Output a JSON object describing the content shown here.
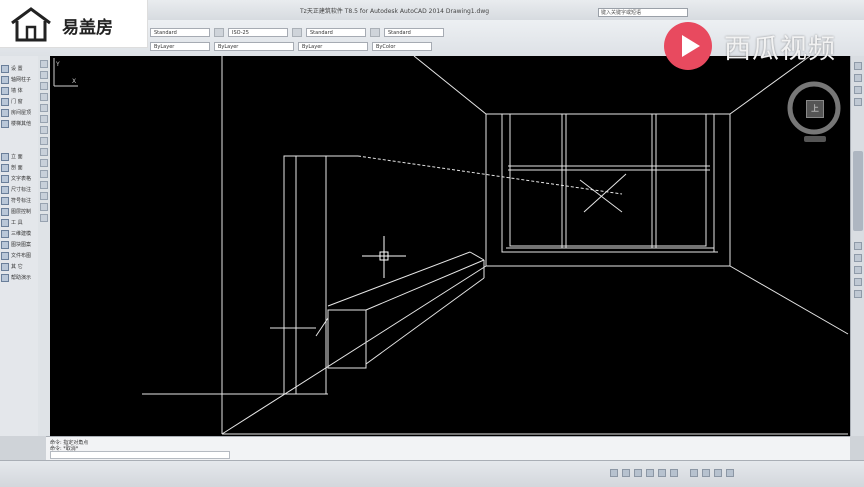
{
  "app": {
    "title": "Tz天正建筑软件 T8.5 for Autodesk AutoCAD 2014   Drawing1.dwg",
    "search_placeholder": "键入关键字或短语"
  },
  "branding": {
    "logo_text": "易盖房",
    "watermark_text": "西瓜视频",
    "watermark_color": "#e84a5f"
  },
  "ribbon": {
    "fields_top": [
      "Standard",
      "ISO-25",
      "Standard",
      "Standard"
    ],
    "fields_bottom": [
      "ByLayer",
      "ByLayer",
      "ByLayer",
      "ByColor"
    ]
  },
  "left_panel": {
    "items": [
      "设  置",
      "轴网柱子",
      "墙  体",
      "门  窗",
      "房间屋顶",
      "楼梯其他",
      "立  面",
      "剖  面",
      "文字表格",
      "尺寸标注",
      "符号标注",
      "图层控制",
      "工  具",
      "三维建模",
      "图块图案",
      "文件布图",
      "其  它",
      "帮助演示"
    ]
  },
  "viewcube": {
    "face_label": "上"
  },
  "command": {
    "history_line1": "命令: 指定对角点",
    "history_line2": "命令: *取消*"
  },
  "colors": {
    "canvas_bg": "#000000",
    "line_color": "#e6e6e6"
  }
}
